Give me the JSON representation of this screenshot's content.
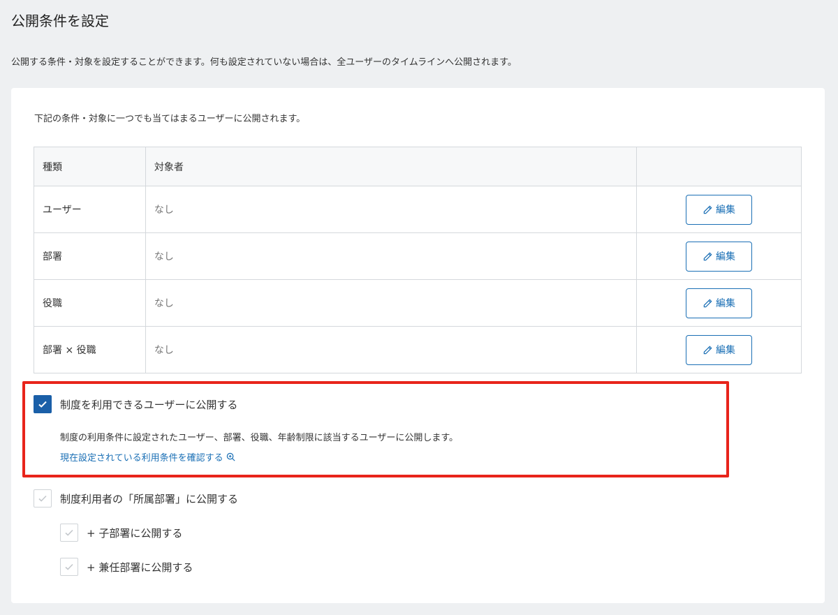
{
  "page": {
    "title": "公開条件を設定",
    "description": "公開する条件・対象を設定することができます。何も設定されていない場合は、全ユーザーのタイムラインへ公開されます。"
  },
  "card": {
    "intro": "下記の条件・対象に一つでも当てはまるユーザーに公開されます。",
    "table": {
      "headers": [
        "種類",
        "対象者",
        ""
      ],
      "rows": [
        {
          "type": "ユーザー",
          "target": "なし",
          "action": "編集"
        },
        {
          "type": "部署",
          "target": "なし",
          "action": "編集"
        },
        {
          "type": "役職",
          "target": "なし",
          "action": "編集"
        },
        {
          "type": "部署 × 役職",
          "target": "なし",
          "action": "編集"
        }
      ]
    },
    "system_users": {
      "checked": true,
      "label": "制度を利用できるユーザーに公開する",
      "description": "制度の利用条件に設定されたユーザー、部署、役職、年齢制限に該当するユーザーに公開します。",
      "link": "現在設定されている利用条件を確認する"
    },
    "department": {
      "checked": true,
      "disabled": true,
      "label": "制度利用者の「所属部署」に公開する",
      "children": [
        {
          "checked": true,
          "disabled": true,
          "label": "+ 子部署に公開する"
        },
        {
          "checked": true,
          "disabled": true,
          "label": "+ 兼任部署に公開する"
        }
      ]
    }
  },
  "colors": {
    "accent": "#1a6fb5",
    "checkbox_checked": "#1a5fa8",
    "highlight_border": "#e8241b",
    "background": "#eef0f2"
  },
  "icons": {
    "edit": "pencil-icon",
    "zoom": "zoom-in-icon",
    "check": "check-icon"
  }
}
